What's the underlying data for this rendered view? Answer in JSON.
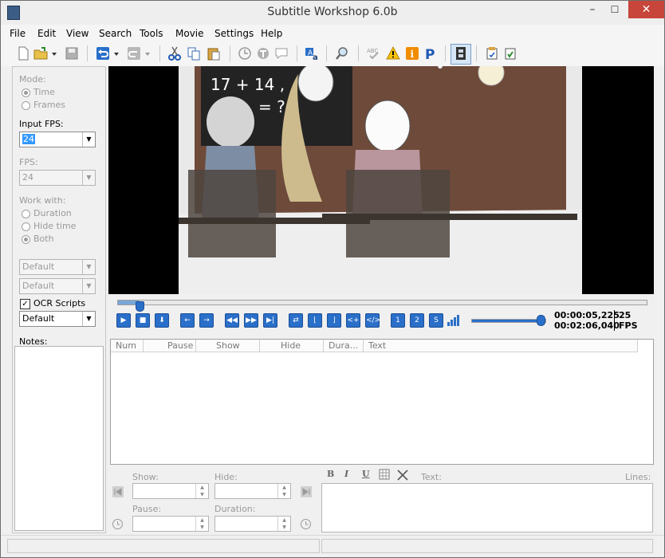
{
  "window": {
    "title": "Subtitle Workshop 6.0b",
    "minimize": "–",
    "maximize": "☐",
    "close": "✕"
  },
  "menu": [
    "File",
    "Edit",
    "View",
    "Search",
    "Tools",
    "Movie",
    "Settings",
    "Help"
  ],
  "left": {
    "mode_label": "Mode:",
    "mode_time": "Time",
    "mode_frames": "Frames",
    "input_fps_label": "Input FPS:",
    "input_fps_value": "24",
    "fps_label": "FPS:",
    "fps_value": "24",
    "work_with_label": "Work with:",
    "ww_duration": "Duration",
    "ww_hide": "Hide time",
    "ww_both": "Both",
    "combo1": "Default",
    "combo2": "Default",
    "ocr_label": "OCR Scripts",
    "ocr_combo": "Default",
    "notes_label": "Notes:"
  },
  "video": {
    "board_text_line1": "17 + 14 ,",
    "board_text_line2": "= ?"
  },
  "player": {
    "time_current": "00:00:05,225",
    "time_total": "00:02:06,040",
    "fps_value": "25",
    "fps_label": "FPS",
    "mode1": "1",
    "mode2": "2",
    "mode3": "S",
    "progress_fraction": 0.04,
    "volume_fraction": 1.0
  },
  "grid": {
    "columns": [
      "Num",
      "Pause",
      "Show",
      "Hide",
      "Dura...",
      "Text"
    ]
  },
  "editor": {
    "show_label": "Show:",
    "hide_label": "Hide:",
    "pause_label": "Pause:",
    "duration_label": "Duration:",
    "text_label": "Text:",
    "lines_label": "Lines:",
    "bold": "B",
    "italic": "I",
    "underline": "U"
  }
}
